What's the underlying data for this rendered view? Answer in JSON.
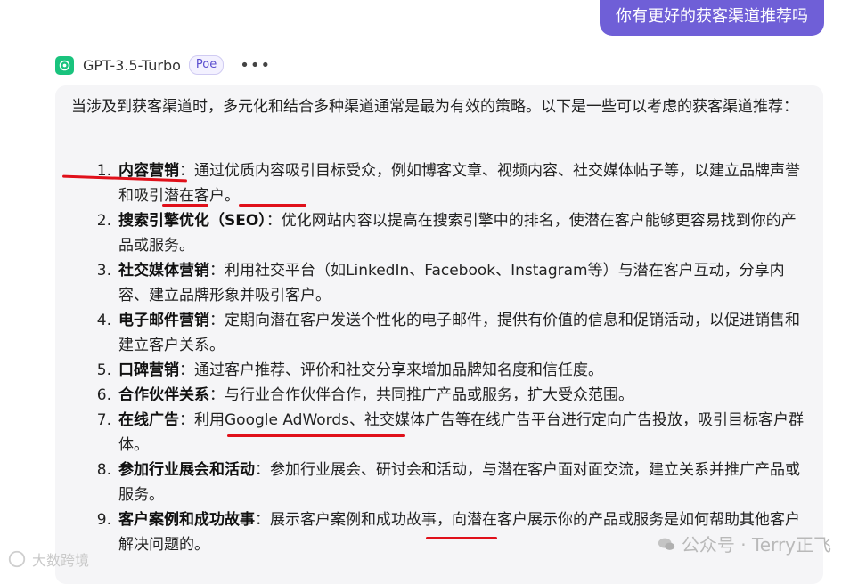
{
  "user_message": "你有更好的获客渠道推荐吗",
  "bot": {
    "name": "GPT-3.5-Turbo",
    "badge": "Poe",
    "more": "•••"
  },
  "message": {
    "intro": "当涉及到获客渠道时，多元化和结合多种渠道通常是最为有效的策略。以下是一些可以考虑的获客渠道推荐：",
    "items": [
      {
        "num": "1.",
        "title": "内容营销",
        "text": "：通过优质内容吸引目标受众，例如博客文章、视频内容、社交媒体帖子等，以建立品牌声誉和吸引潜在客户。"
      },
      {
        "num": "2.",
        "title": "搜索引擎优化（SEO）",
        "text": "：优化网站内容以提高在搜索引擎中的排名，使潜在客户能够更容易找到你的产品或服务。"
      },
      {
        "num": "3.",
        "title": "社交媒体营销",
        "text": "：利用社交平台（如LinkedIn、Facebook、Instagram等）与潜在客户互动，分享内容、建立品牌形象并吸引客户。"
      },
      {
        "num": "4.",
        "title": "电子邮件营销",
        "text": "：定期向潜在客户发送个性化的电子邮件，提供有价值的信息和促销活动，以促进销售和建立客户关系。"
      },
      {
        "num": "5.",
        "title": "口碑营销",
        "text": "：通过客户推荐、评价和社交分享来增加品牌知名度和信任度。"
      },
      {
        "num": "6.",
        "title": "合作伙伴关系",
        "text": "：与行业合作伙伴合作，共同推广产品或服务，扩大受众范围。"
      },
      {
        "num": "7.",
        "title": "在线广告",
        "text": "：利用Google AdWords、社交媒体广告等在线广告平台进行定向广告投放，吸引目标客户群体。"
      },
      {
        "num": "8.",
        "title": "参加行业展会和活动",
        "text": "：参加行业展会、研讨会和活动，与潜在客户面对面交流，建立关系并推广产品或服务。"
      },
      {
        "num": "9.",
        "title": "客户案例和成功故事",
        "text": "：展示客户案例和成功故事，向潜在客户展示你的产品或服务是如何帮助其他客户解决问题的。"
      }
    ]
  },
  "watermarks": {
    "left": "大数跨境",
    "right": "公众号 · Terry正飞"
  },
  "colors": {
    "accent": "#6f5fd7",
    "annotation": "#e0101a",
    "card": "#f5f5f7"
  }
}
